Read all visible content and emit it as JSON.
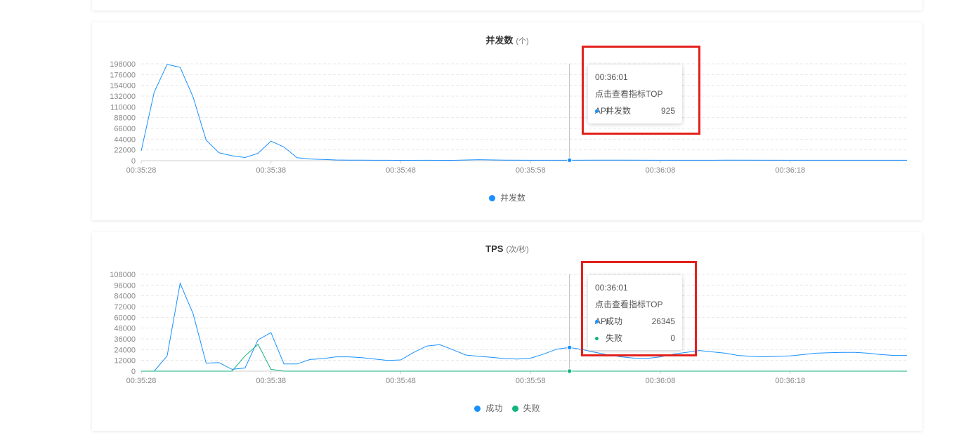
{
  "colors": {
    "success": "#1890ff",
    "fail": "#13b47d",
    "highlight_box": "#e3211c"
  },
  "concurrency": {
    "title": "并发数",
    "unit": "(个)",
    "legend": [
      {
        "label": "并发数",
        "color": "#1890ff"
      }
    ],
    "tooltip": {
      "time": "00:36:01",
      "link": "点击查看指标TOP API",
      "rows": [
        {
          "label": "并发数",
          "value": "925",
          "color": "#1890ff"
        }
      ]
    }
  },
  "tps": {
    "title": "TPS",
    "unit": "(次/秒)",
    "legend": [
      {
        "label": "成功",
        "color": "#1890ff"
      },
      {
        "label": "失败",
        "color": "#13b47d"
      }
    ],
    "tooltip": {
      "time": "00:36:01",
      "link": "点击查看指标TOP API",
      "rows": [
        {
          "label": "成功",
          "value": "26345",
          "color": "#1890ff"
        },
        {
          "label": "失败",
          "value": "0",
          "color": "#13b47d"
        }
      ]
    }
  },
  "chart_data": [
    {
      "type": "line",
      "title": "并发数",
      "ylabel": "(个)",
      "ylim": [
        0,
        198000
      ],
      "y_ticks": [
        "0",
        "22000",
        "44000",
        "66000",
        "88000",
        "110000",
        "132000",
        "154000",
        "176000",
        "198000"
      ],
      "x_ticks": [
        "00:35:28",
        "00:35:38",
        "00:35:48",
        "00:35:58",
        "00:36:08",
        "00:36:18"
      ],
      "x_start_seconds": 0,
      "x_range": [
        0,
        59
      ],
      "highlight_x": 33,
      "grid": true,
      "legend_position": "bottom",
      "series": [
        {
          "name": "并发数",
          "color": "#1890ff",
          "x": [
            0,
            1,
            2,
            3,
            4,
            5,
            6,
            7,
            8,
            9,
            10,
            11,
            12,
            13,
            14,
            15,
            16,
            17,
            18,
            19,
            20,
            22,
            24,
            26,
            28,
            30,
            32,
            33,
            35,
            40,
            45,
            50,
            55,
            59
          ],
          "values": [
            20000,
            140000,
            197000,
            191000,
            130000,
            42000,
            16000,
            10000,
            6500,
            15000,
            40000,
            28000,
            6000,
            3500,
            2500,
            1500,
            1200,
            1000,
            900,
            800,
            700,
            900,
            700,
            2000,
            1200,
            900,
            900,
            925,
            1100,
            800,
            1000,
            800,
            900,
            900
          ]
        }
      ]
    },
    {
      "type": "line",
      "title": "TPS",
      "ylabel": "(次/秒)",
      "ylim": [
        0,
        108000
      ],
      "y_ticks": [
        "0",
        "12000",
        "24000",
        "36000",
        "48000",
        "60000",
        "72000",
        "84000",
        "96000",
        "108000"
      ],
      "x_ticks": [
        "00:35:28",
        "00:35:38",
        "00:35:48",
        "00:35:58",
        "00:36:08",
        "00:36:18"
      ],
      "x_range": [
        0,
        59
      ],
      "highlight_x": 33,
      "grid": true,
      "legend_position": "bottom",
      "series": [
        {
          "name": "成功",
          "color": "#1890ff",
          "x": [
            0,
            1,
            2,
            3,
            4,
            5,
            6,
            7,
            8,
            9,
            10,
            11,
            12,
            13,
            14,
            15,
            16,
            17,
            18,
            19,
            20,
            21,
            22,
            23,
            24,
            25,
            26,
            27,
            28,
            29,
            30,
            31,
            32,
            33,
            34,
            35,
            36,
            37,
            38,
            39,
            40,
            41,
            42,
            43,
            44,
            45,
            46,
            47,
            48,
            49,
            50,
            51,
            52,
            53,
            54,
            55,
            56,
            57,
            58,
            59
          ],
          "values": [
            0,
            0,
            17000,
            98000,
            64000,
            9000,
            9500,
            2000,
            3500,
            35000,
            43000,
            8000,
            8000,
            13000,
            14000,
            16000,
            16000,
            15000,
            13500,
            12000,
            12500,
            21000,
            28000,
            29500,
            24000,
            18000,
            16500,
            15500,
            14000,
            13500,
            14500,
            19000,
            24500,
            26345,
            24000,
            21000,
            18000,
            16000,
            14500,
            14200,
            16000,
            19000,
            21000,
            23000,
            21500,
            20000,
            17500,
            16500,
            16000,
            16500,
            17000,
            18500,
            20000,
            20500,
            21000,
            21000,
            20000,
            18500,
            17500,
            17500
          ]
        },
        {
          "name": "失败",
          "color": "#13b47d",
          "x": [
            0,
            1,
            2,
            3,
            4,
            5,
            6,
            7,
            8,
            9,
            10,
            11,
            12,
            13,
            20,
            30,
            33,
            40,
            50,
            59
          ],
          "values": [
            0,
            0,
            0,
            0,
            0,
            0,
            0,
            0,
            17000,
            30000,
            2000,
            0,
            0,
            0,
            0,
            0,
            0,
            0,
            0,
            0
          ]
        }
      ]
    }
  ]
}
